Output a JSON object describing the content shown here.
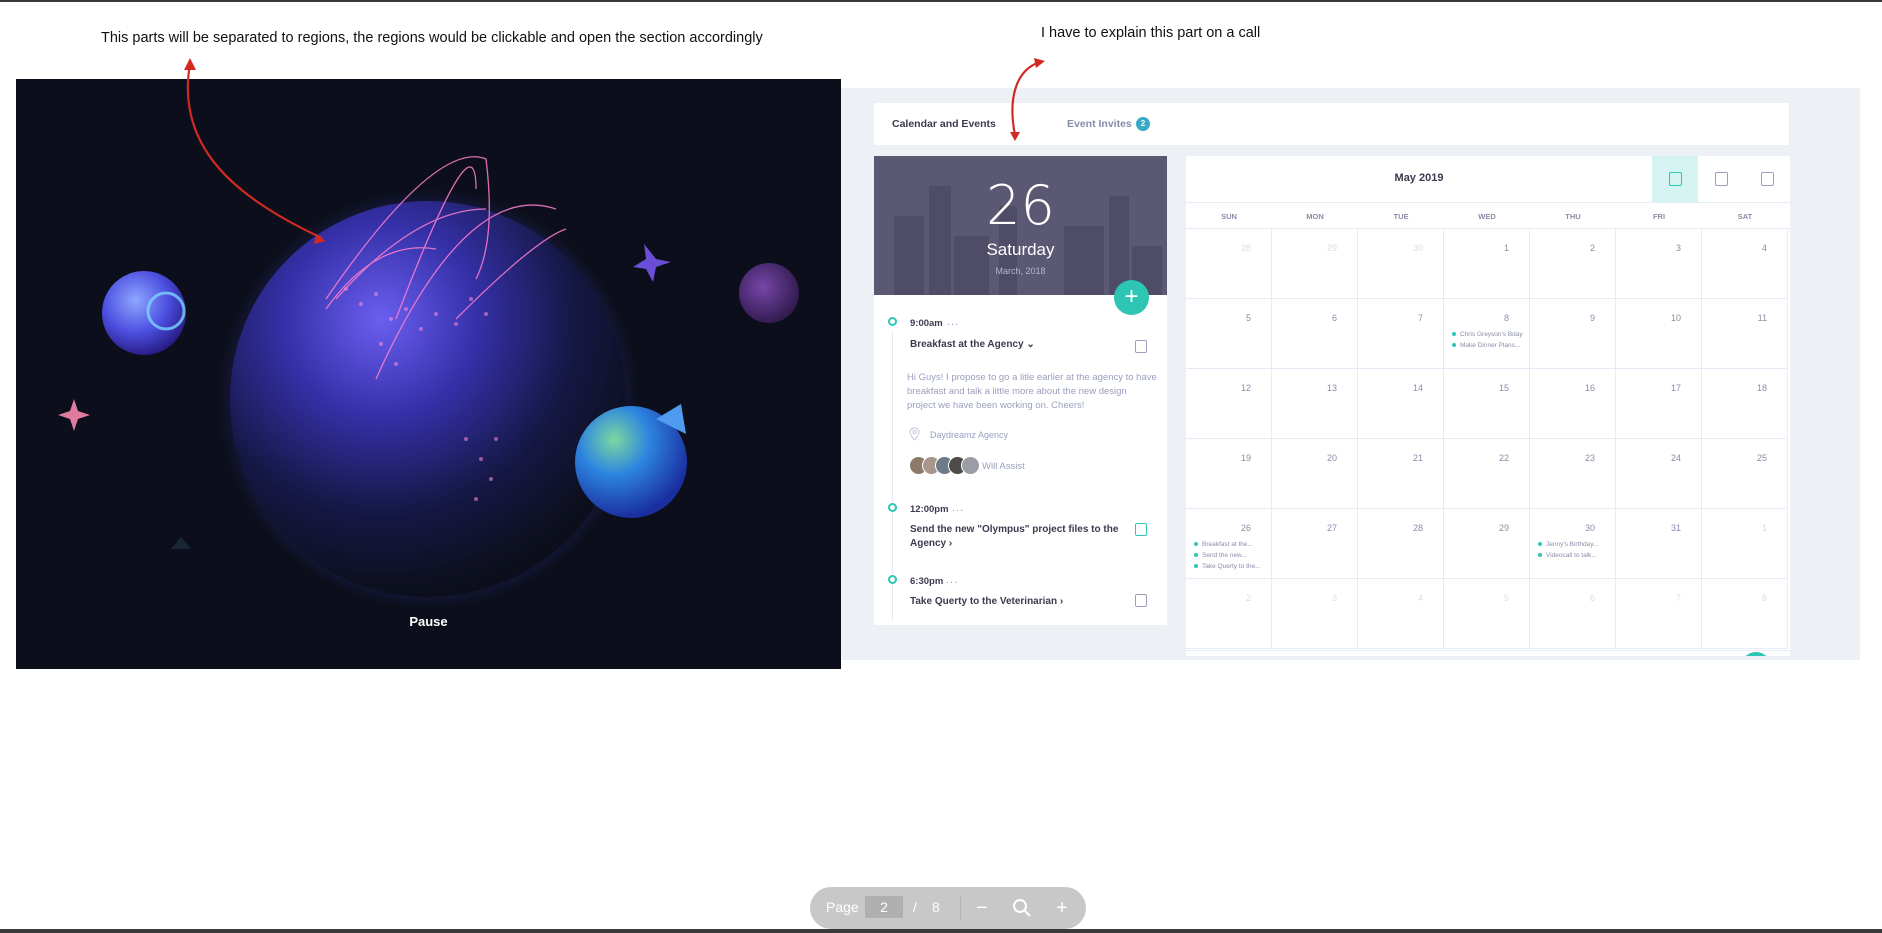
{
  "annotations": {
    "left_note": "This parts will be separated to regions, the regions would be clickable and open the section accordingly",
    "right_note": "I have to explain this part on a call",
    "arrow_color": "#d02a22"
  },
  "hero": {
    "pause_label": "Pause",
    "background": "#0c0f1b"
  },
  "calendar": {
    "tabs": [
      {
        "label": "Calendar and Events"
      },
      {
        "label": "Event Invites",
        "badge": "2"
      }
    ],
    "day": {
      "number": "26",
      "weekday": "Saturday",
      "month_year": "March, 2018",
      "add_icon": "+"
    },
    "events": [
      {
        "time": "9:00am",
        "title": "Breakfast at the Agency",
        "description": "Hi Guys! I propose to go a litle earlier at the agency to have breakfast and talk a little more about the new design project we have been working on. Cheers!",
        "location": "Daydreamz Agency",
        "assist": "Will Assist"
      },
      {
        "time": "12:00pm",
        "title": "Send the new \"Olympus\" project files to the Agency"
      },
      {
        "time": "6:30pm",
        "title": "Take Querty to the Veterinarian"
      }
    ],
    "month": {
      "title": "May 2019",
      "weekdays": [
        "SUN",
        "MON",
        "TUE",
        "WED",
        "THU",
        "FRI",
        "SAT"
      ],
      "weeks": [
        [
          "28",
          "29",
          "30",
          "1",
          "2",
          "3",
          "4"
        ],
        [
          "5",
          "6",
          "7",
          "8",
          "9",
          "10",
          "11"
        ],
        [
          "12",
          "13",
          "14",
          "15",
          "16",
          "17",
          "18"
        ],
        [
          "19",
          "20",
          "21",
          "22",
          "23",
          "24",
          "25"
        ],
        [
          "26",
          "27",
          "28",
          "29",
          "30",
          "31",
          "1"
        ],
        [
          "2",
          "3",
          "4",
          "5",
          "6",
          "7",
          "8"
        ]
      ],
      "cell_events": {
        "wed8": [
          "Chris Greyson's Bday",
          "Make Dinner Plans..."
        ],
        "sun26": [
          "Breakfast at the...",
          "Send the new...",
          "Take Querty to the..."
        ],
        "thu30": [
          "Jenny's Birthday...",
          "Videocall to talk..."
        ]
      }
    },
    "accent_color": "#2dc5b3"
  },
  "pager": {
    "page_label": "Page",
    "current_page": "2",
    "separator": "/",
    "total_pages": "8",
    "zoom_out": "−",
    "zoom_in": "+",
    "zoom_icon": "magnifier-icon"
  }
}
